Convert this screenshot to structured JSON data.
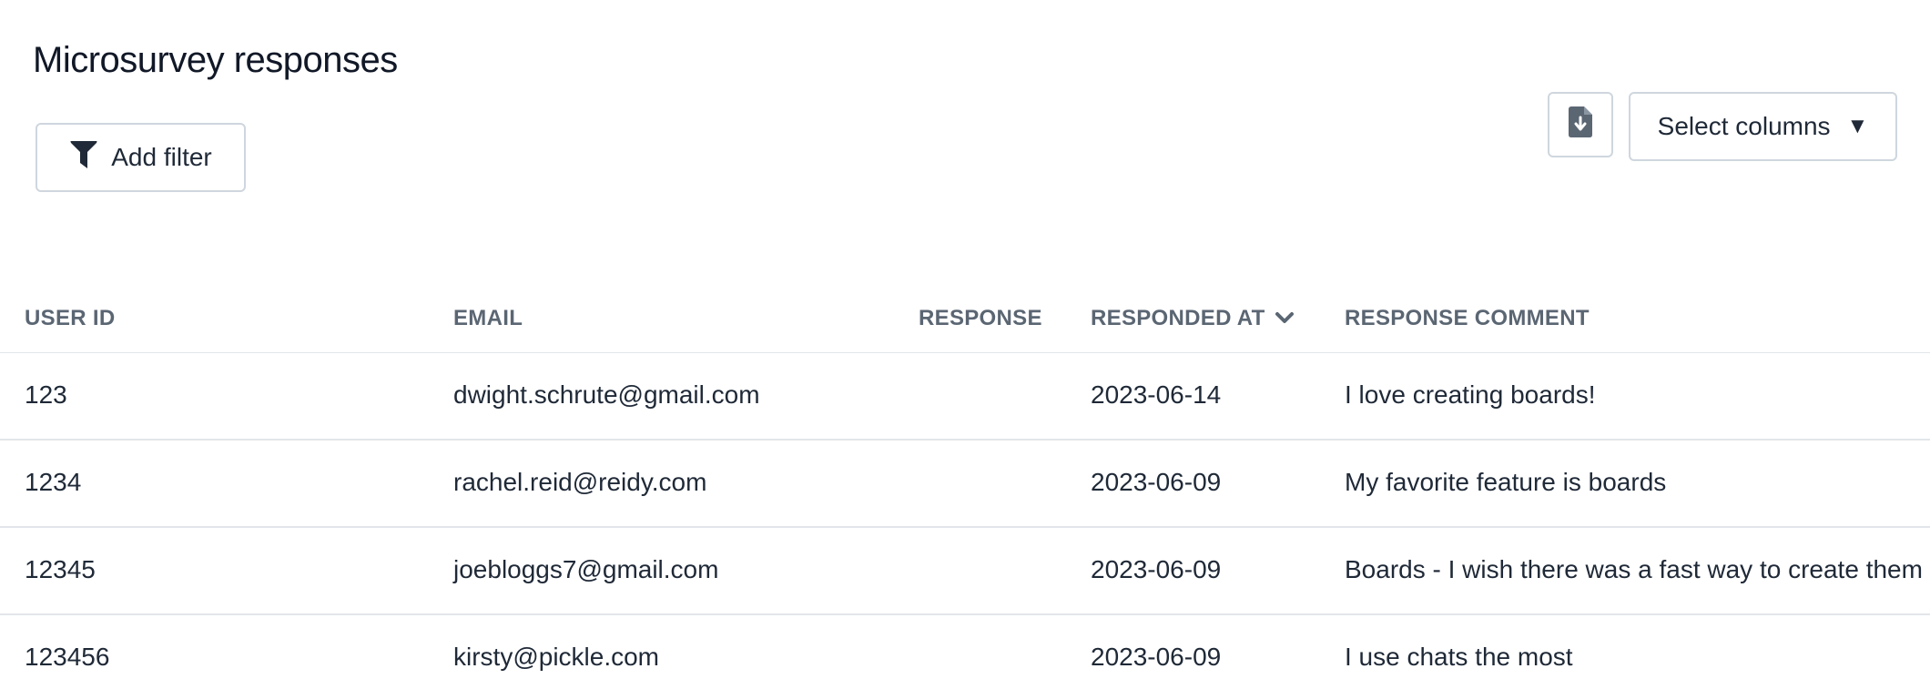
{
  "page": {
    "title": "Microsurvey responses"
  },
  "toolbar": {
    "add_filter_label": "Add filter",
    "add_filter_icon": "filter-icon",
    "export_icon": "file-download-icon",
    "select_columns_label": "Select columns",
    "select_columns_caret": "▼"
  },
  "table": {
    "columns": [
      "USER ID",
      "EMAIL",
      "RESPONSE",
      "RESPONDED AT",
      "RESPONSE COMMENT"
    ],
    "sorted_column": "RESPONDED AT",
    "sort_direction": "descending",
    "rows": [
      {
        "user_id": "123",
        "email": "dwight.schrute@gmail.com",
        "response": "",
        "responded_at": "2023-06-14",
        "comment": "I love creating boards!"
      },
      {
        "user_id": "1234",
        "email": "rachel.reid@reidy.com",
        "response": "",
        "responded_at": "2023-06-09",
        "comment": "My favorite feature is boards"
      },
      {
        "user_id": "12345",
        "email": "joebloggs7@gmail.com",
        "response": "",
        "responded_at": "2023-06-09",
        "comment": "Boards - I wish there was a fast way to create them"
      },
      {
        "user_id": "123456",
        "email": "kirsty@pickle.com",
        "response": "",
        "responded_at": "2023-06-09",
        "comment": "I use chats the most"
      }
    ]
  },
  "colors": {
    "text": "#1f2937",
    "header_text": "#5b6673",
    "border": "#cfd6de",
    "divider": "#e2e6ea",
    "icon": "#1f2937",
    "export_icon": "#5b6673"
  }
}
